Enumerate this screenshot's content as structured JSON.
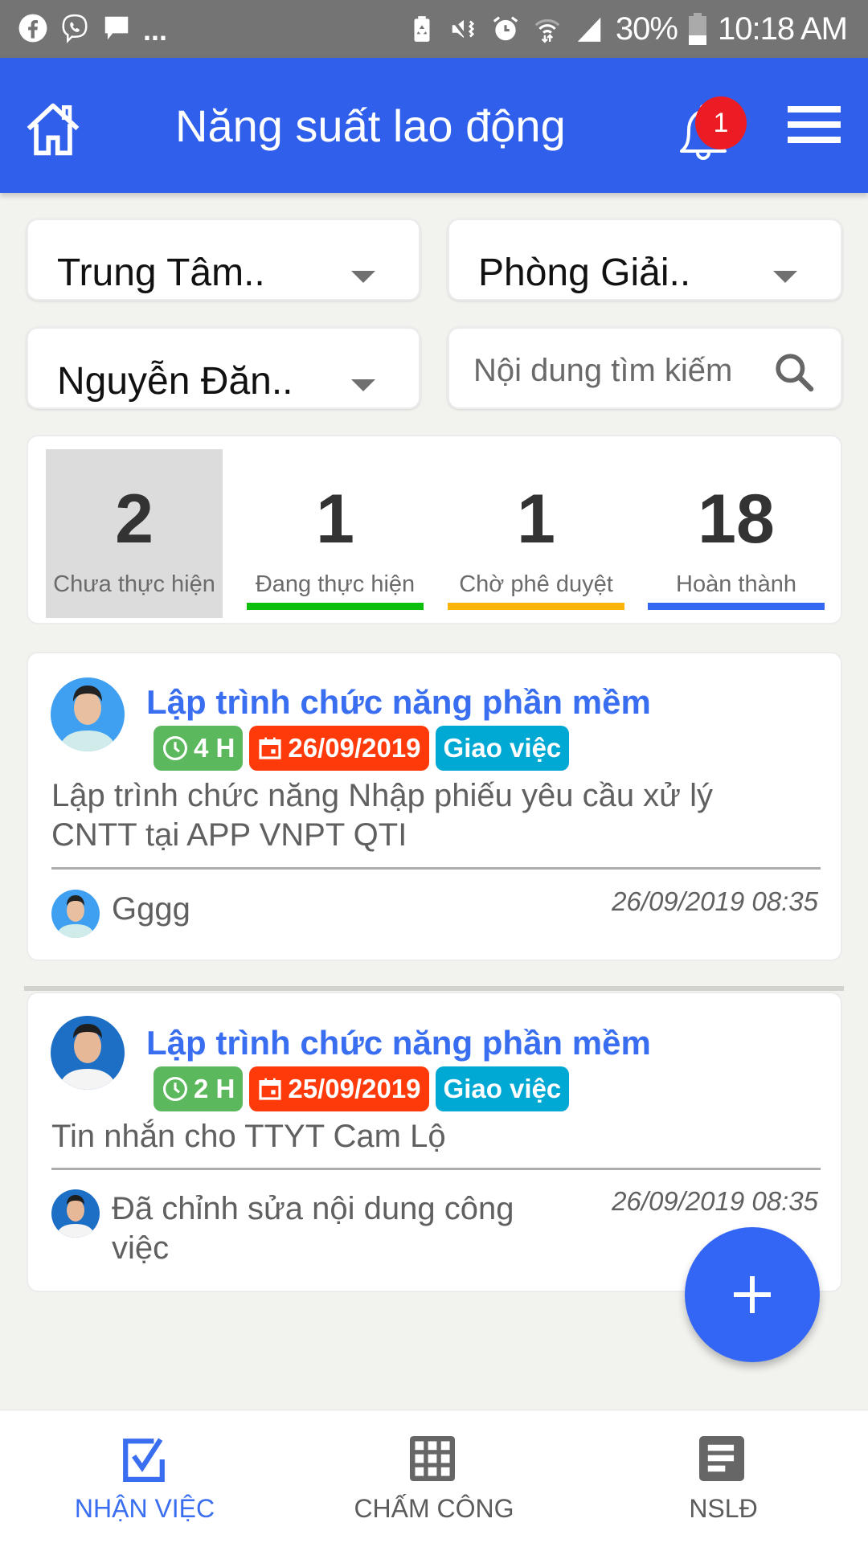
{
  "status_bar": {
    "left_icons": [
      "facebook-icon",
      "viber-icon",
      "message-icon"
    ],
    "overflow": "...",
    "right_icons": [
      "battery-saver-icon",
      "vibrate-mute-icon",
      "alarm-icon",
      "wifi-icon",
      "signal-icon"
    ],
    "battery": "30%",
    "time": "10:18 AM"
  },
  "header": {
    "title": "Năng suất lao động",
    "notification_count": "1",
    "colors": {
      "bar": "#3060eb",
      "badge": "#ec1c24"
    }
  },
  "filters": {
    "center": "Trung Tâm..",
    "department": "Phòng Giải..",
    "employee": "Nguyễn Đăn..",
    "search_placeholder": "Nội dung tìm kiếm"
  },
  "stats": [
    {
      "count": "2",
      "label": "Chưa thực hiện",
      "color": "#dcdcdc",
      "selected": true
    },
    {
      "count": "1",
      "label": "Đang thực hiện",
      "color": "#0cbf0c",
      "selected": false
    },
    {
      "count": "1",
      "label": "Chờ phê duyệt",
      "color": "#fbb40a",
      "selected": false
    },
    {
      "count": "18",
      "label": "Hoàn thành",
      "color": "#3468f0",
      "selected": false
    }
  ],
  "tasks": [
    {
      "title": "Lập trình chức năng phần mềm",
      "hours": "4 H",
      "date": "26/09/2019",
      "type": "Giao việc",
      "description": "Lập trình chức năng Nhập phiếu yêu cầu xử lý CNTT tại APP VNPT QTI",
      "comment": "Gggg",
      "timestamp": "26/09/2019 08:35"
    },
    {
      "title": "Lập trình chức năng phần mềm",
      "hours": "2 H",
      "date": "25/09/2019",
      "type": "Giao việc",
      "description": "Tin nhắn cho TTYT Cam Lộ",
      "comment": "Đã chỉnh sửa nội dung công việc",
      "timestamp": "26/09/2019 08:35"
    }
  ],
  "fab": {
    "icon": "plus-icon"
  },
  "bottom_nav": [
    {
      "label": "NHẬN VIỆC",
      "icon": "checkbox-icon",
      "active": true
    },
    {
      "label": "CHẤM CÔNG",
      "icon": "grid-icon",
      "active": false
    },
    {
      "label": "NSLĐ",
      "icon": "list-document-icon",
      "active": false
    }
  ]
}
